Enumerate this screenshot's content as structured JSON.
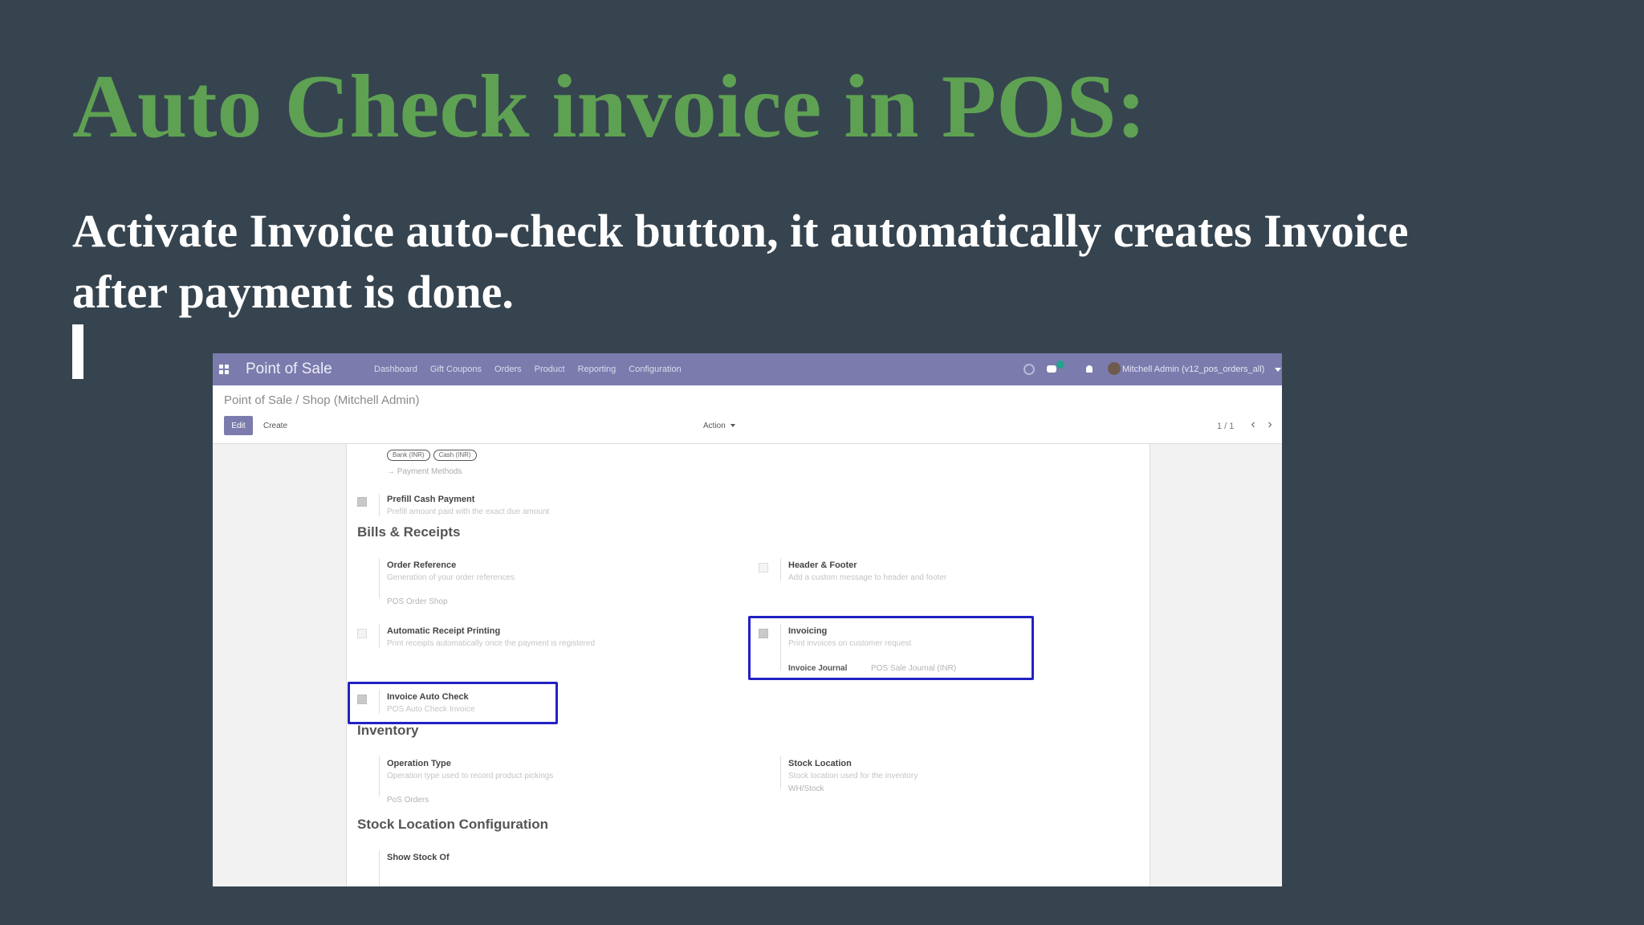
{
  "slide": {
    "title": "Auto Check invoice in POS:",
    "subtitle": "Activate Invoice auto-check button, it automatically creates Invoice after payment is done."
  },
  "app": {
    "name": "Point of Sale",
    "menu": [
      "Dashboard",
      "Gift Coupons",
      "Orders",
      "Product",
      "Reporting",
      "Configuration"
    ],
    "user": "Mitchell Admin (v12_pos_orders_all)"
  },
  "control_panel": {
    "breadcrumb": "Point of Sale / Shop (Mitchell Admin)",
    "edit_label": "Edit",
    "create_label": "Create",
    "action_label": "Action",
    "pager": "1 / 1"
  },
  "form": {
    "payment_tags": [
      "Bank (INR)",
      "Cash (INR)"
    ],
    "payment_methods_link": "Payment Methods",
    "prefill_cash": {
      "label": "Prefill Cash Payment",
      "desc": "Prefill amount paid with the exact due amount"
    },
    "bills_heading": "Bills & Receipts",
    "order_reference": {
      "label": "Order Reference",
      "desc": "Generation of your order references",
      "value": "POS Order Shop"
    },
    "header_footer": {
      "label": "Header & Footer",
      "desc": "Add a custom message to header and footer"
    },
    "auto_receipt": {
      "label": "Automatic Receipt Printing",
      "desc": "Print receipts automatically once the payment is registered"
    },
    "invoicing": {
      "label": "Invoicing",
      "desc": "Print invoices on customer request",
      "journal_label": "Invoice Journal",
      "journal_value": "POS Sale Journal (INR)"
    },
    "invoice_auto_check": {
      "label": "Invoice Auto Check",
      "desc": "POS Auto Check Invoice"
    },
    "inventory_heading": "Inventory",
    "operation_type": {
      "label": "Operation Type",
      "desc": "Operation type used to record product pickings",
      "value": "PoS Orders"
    },
    "stock_location": {
      "label": "Stock Location",
      "desc": "Stock location used for the inventory",
      "value": "WH/Stock"
    },
    "stock_config_heading": "Stock Location Configuration",
    "show_stock": {
      "label": "Show Stock Of"
    }
  },
  "colors": {
    "background": "#36444f",
    "title": "#5ea153",
    "navbar": "#7b7bad",
    "highlight": "#2221c4"
  }
}
